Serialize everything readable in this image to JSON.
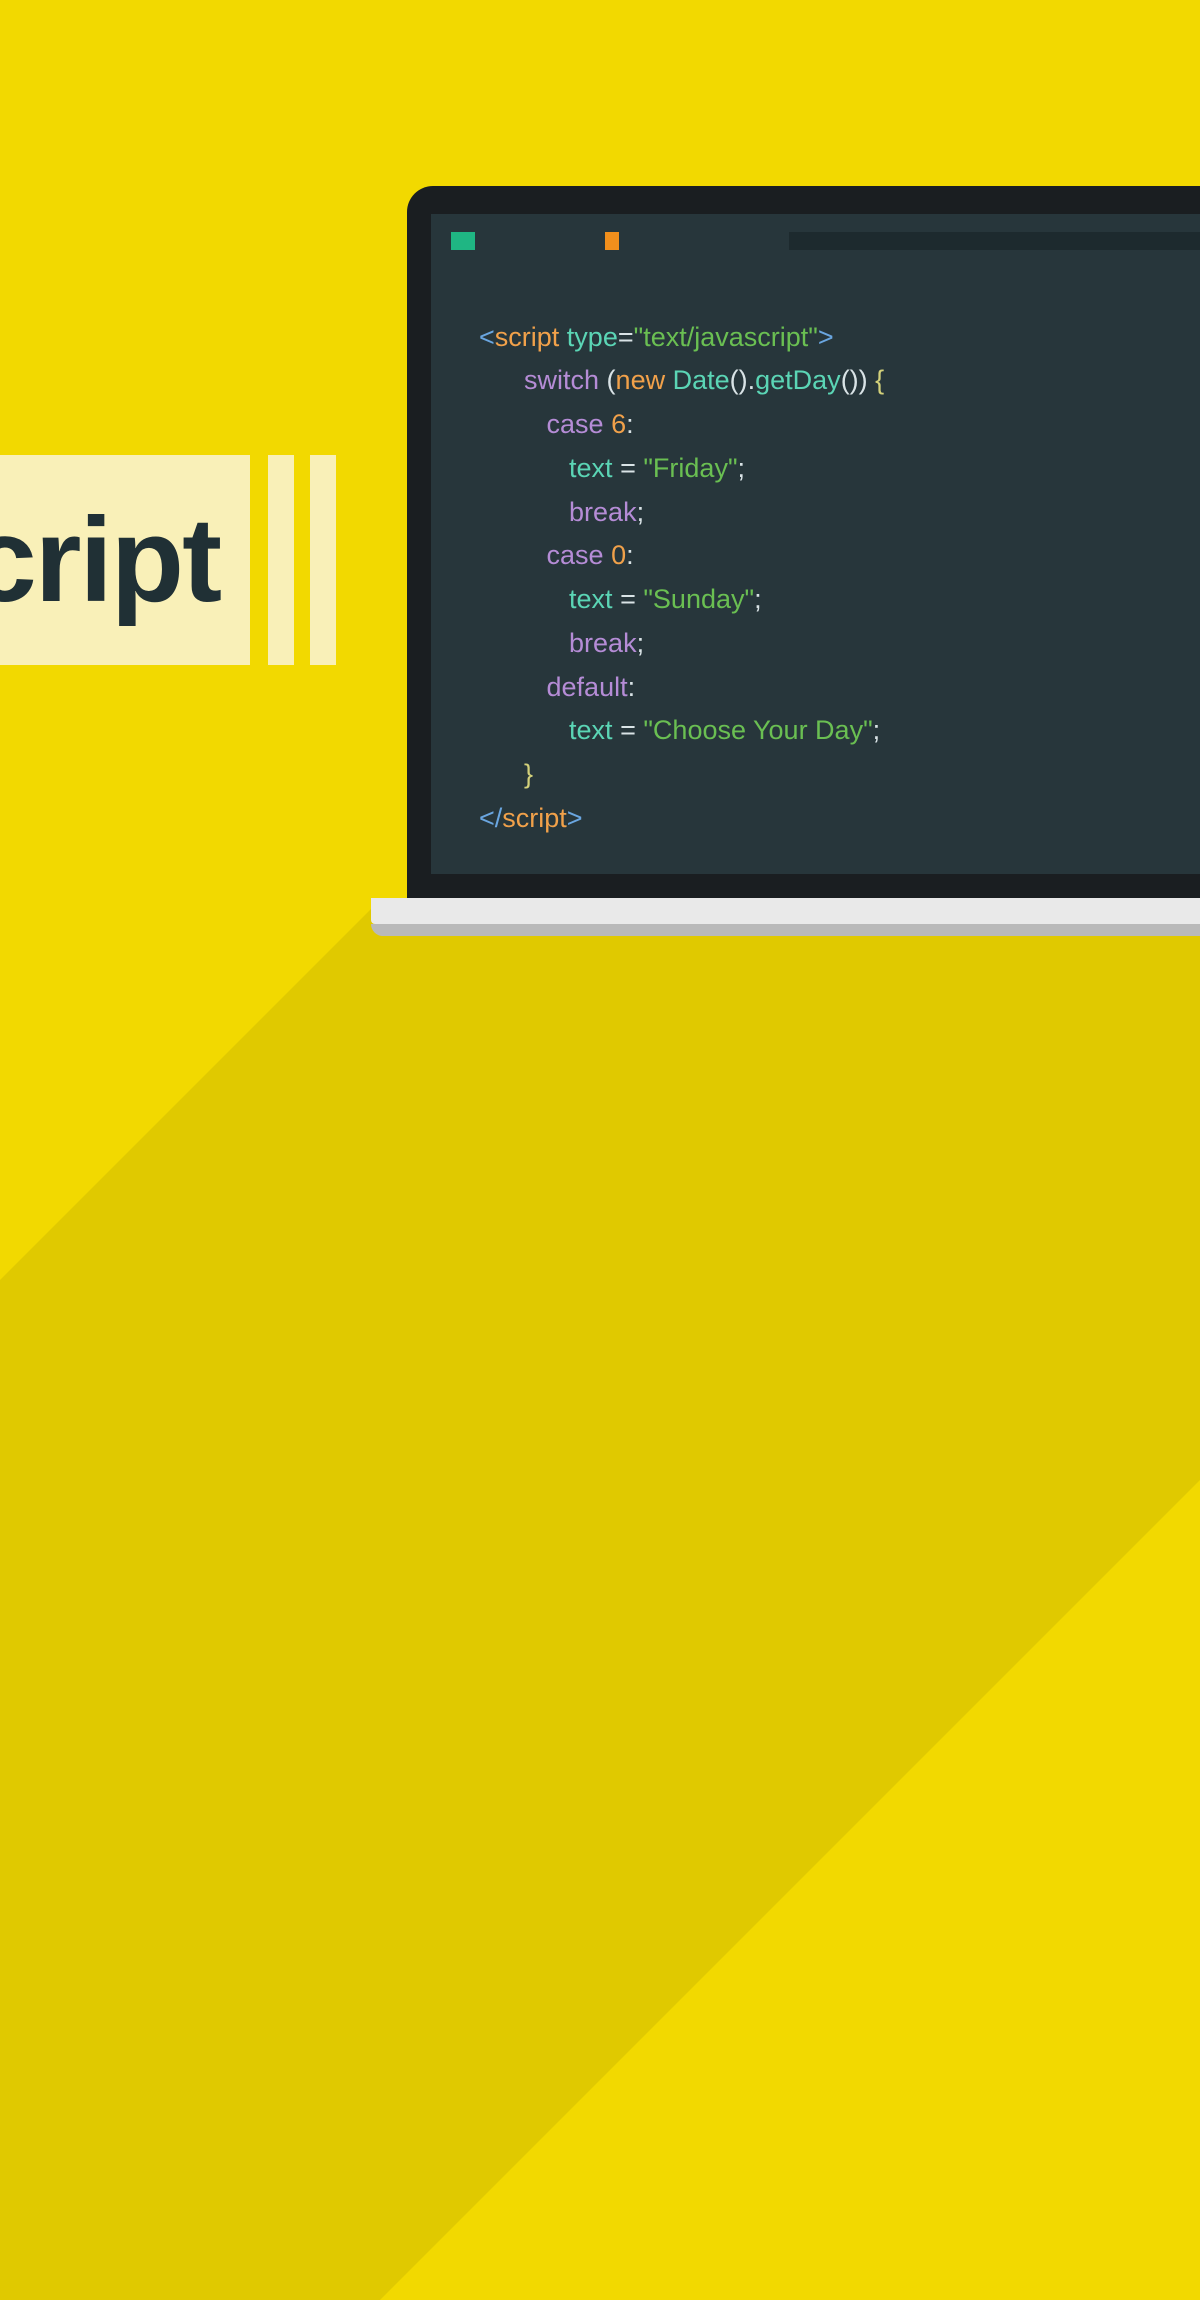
{
  "banner": {
    "title": "cript"
  },
  "colors": {
    "background": "#f2d900",
    "banner_bg": "#f9f0b8",
    "banner_text": "#203035",
    "screen_bg": "#27363b",
    "bezel": "#1a1e21",
    "tab_green": "#1fb683",
    "tab_orange": "#f18f1c",
    "tab_dark": "#1d2a2e",
    "shadow": "#e0c900"
  },
  "code": {
    "line1": {
      "open": "<",
      "tag": "script ",
      "attr": "type",
      "eq": "=",
      "val": "\"text/javascript\"",
      "close": ">"
    },
    "line2": {
      "kw": "switch ",
      "paren_o": "(",
      "new": "new ",
      "date": "Date",
      "paren": "().",
      "getday": "getDay",
      "paren_c": "()) ",
      "brace": "{"
    },
    "line3": {
      "kw": "case ",
      "num": "6",
      "colon": ":"
    },
    "line4": {
      "id": "text ",
      "eq": "= ",
      "str": "\"Friday\"",
      "semi": ";"
    },
    "line5": {
      "kw": "break",
      "semi": ";"
    },
    "line6": {
      "kw": "case ",
      "num": "0",
      "colon": ":"
    },
    "line7": {
      "id": "text ",
      "eq": "= ",
      "str": "\"Sunday\"",
      "semi": ";"
    },
    "line8": {
      "kw": "break",
      "semi": ";"
    },
    "line9": {
      "kw": "default",
      "colon": ":"
    },
    "line10": {
      "id": "text ",
      "eq": "= ",
      "str": "\"Choose Your Day\"",
      "semi": ";"
    },
    "line11": {
      "brace": "}"
    },
    "line12": {
      "open": "</",
      "tag": "script",
      "close": ">"
    }
  }
}
